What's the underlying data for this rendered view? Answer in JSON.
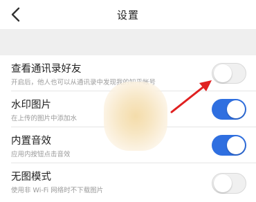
{
  "header": {
    "title": "设置"
  },
  "settings": [
    {
      "label": "查看通讯录好友",
      "description": "开启后，他人也可以从通讯录中发现我的知乎帐号",
      "enabled": false
    },
    {
      "label": "水印图片",
      "description": "在上传的图片中添加水",
      "enabled": true
    },
    {
      "label": "内置音效",
      "description": "应用内按钮点击音效",
      "enabled": true
    },
    {
      "label": "无图模式",
      "description": "使用非 Wi-Fi 网络时不下载图片",
      "enabled": false
    }
  ],
  "colors": {
    "toggle_on": "#2f6fe0",
    "annotation_arrow": "#e02020"
  },
  "icons": {
    "back": "back-chevron-icon"
  }
}
